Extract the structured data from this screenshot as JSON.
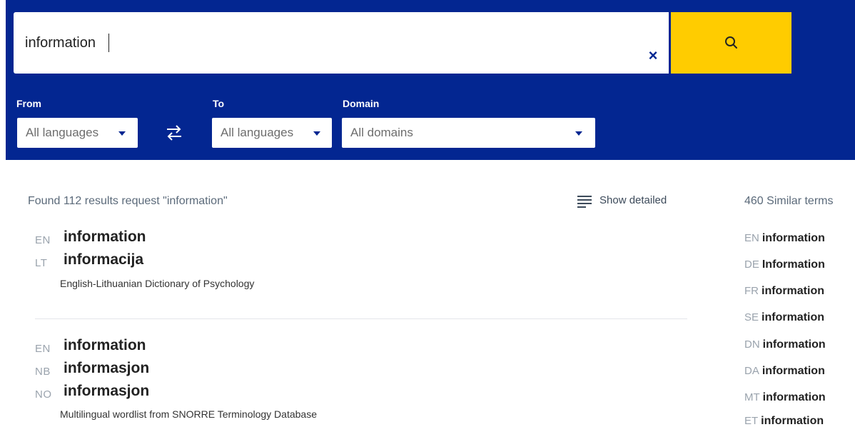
{
  "search": {
    "value": "information",
    "clear_icon": "×"
  },
  "filters": {
    "from_label": "From",
    "from_value": "All languages",
    "to_label": "To",
    "to_value": "All languages",
    "domain_label": "Domain",
    "domain_value": "All domains"
  },
  "results": {
    "summary": "Found 112 results request \"information\"",
    "show_detailed": "Show detailed",
    "entries": [
      {
        "terms": [
          {
            "lang": "EN",
            "term": "information"
          },
          {
            "lang": "LT",
            "term": "informacija"
          }
        ],
        "source": "English-Lithuanian Dictionary of Psychology"
      },
      {
        "terms": [
          {
            "lang": "EN",
            "term": "information"
          },
          {
            "lang": "NB",
            "term": "informasjon"
          },
          {
            "lang": "NO",
            "term": "informasjon"
          }
        ],
        "source": "Multilingual wordlist from SNORRE Terminology Database"
      }
    ]
  },
  "similar": {
    "title": "460 Similar terms",
    "items": [
      {
        "lang": "EN",
        "term": "information"
      },
      {
        "lang": "DE",
        "term": "Information"
      },
      {
        "lang": "FR",
        "term": "information"
      },
      {
        "lang": "SE",
        "term": "information"
      },
      {
        "lang": "DN",
        "term": "information"
      },
      {
        "lang": "DA",
        "term": "information"
      },
      {
        "lang": "MT",
        "term": "information"
      },
      {
        "lang": "ET",
        "term": "information"
      }
    ]
  },
  "colors": {
    "header_bg": "#032691",
    "search_button": "#ffcc00"
  }
}
